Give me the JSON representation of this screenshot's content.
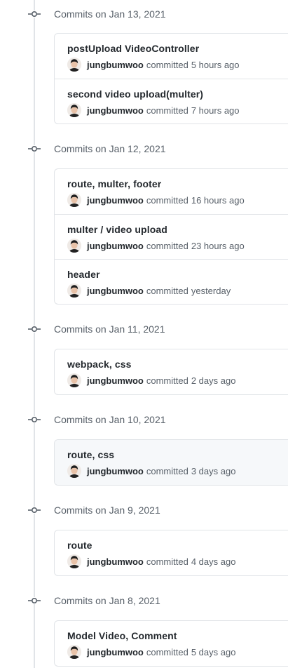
{
  "commit_groups": [
    {
      "title": "Commits on Jan 13, 2021",
      "commits": [
        {
          "message": "postUpload VideoController",
          "author": "jungbumwoo",
          "verb": "committed",
          "time": "5 hours ago"
        },
        {
          "message": "second video upload(multer)",
          "author": "jungbumwoo",
          "verb": "committed",
          "time": "7 hours ago"
        }
      ]
    },
    {
      "title": "Commits on Jan 12, 2021",
      "commits": [
        {
          "message": "route, multer, footer",
          "author": "jungbumwoo",
          "verb": "committed",
          "time": "16 hours ago"
        },
        {
          "message": "multer / video upload",
          "author": "jungbumwoo",
          "verb": "committed",
          "time": "23 hours ago"
        },
        {
          "message": "header",
          "author": "jungbumwoo",
          "verb": "committed",
          "time": "yesterday"
        }
      ]
    },
    {
      "title": "Commits on Jan 11, 2021",
      "commits": [
        {
          "message": "webpack, css",
          "author": "jungbumwoo",
          "verb": "committed",
          "time": "2 days ago"
        }
      ]
    },
    {
      "title": "Commits on Jan 10, 2021",
      "commits": [
        {
          "message": "route, css",
          "author": "jungbumwoo",
          "verb": "committed",
          "time": "3 days ago"
        }
      ]
    },
    {
      "title": "Commits on Jan 9, 2021",
      "commits": [
        {
          "message": "route",
          "author": "jungbumwoo",
          "verb": "committed",
          "time": "4 days ago"
        }
      ]
    },
    {
      "title": "Commits on Jan 8, 2021",
      "commits": [
        {
          "message": "Model Video, Comment",
          "author": "jungbumwoo",
          "verb": "committed",
          "time": "5 days ago"
        }
      ]
    }
  ]
}
